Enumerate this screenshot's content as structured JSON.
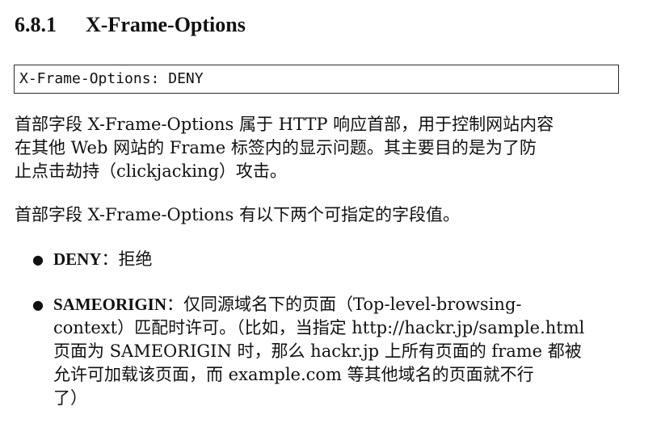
{
  "section": {
    "number": "6.8.1",
    "title": "X-Frame-Options"
  },
  "code": "X-Frame-Options: DENY",
  "paragraph1": [
    "首部字段 X-Frame-Options 属于 HTTP 响应首部，用于控制网站内容",
    "在其他 Web 网站的 Frame 标签内的显示问题。其主要目的是为了防",
    "止点击劫持（clickjacking）攻击。"
  ],
  "paragraph2": "首部字段 X-Frame-Options 有以下两个可指定的字段值。",
  "bullets": [
    {
      "marker": "●",
      "term": "DENY",
      "separator": "：",
      "lines": [
        "拒绝"
      ]
    },
    {
      "marker": "●",
      "term": "SAMEORIGIN",
      "separator": "：",
      "lines": [
        "仅同源域名下的页面（Top-level-browsing-",
        "context）匹配时许可。（比如，当指定 http://hackr.jp/sample.html",
        "页面为 SAMEORIGIN 时，那么 hackr.jp 上所有页面的 frame 都被",
        "允许可加载该页面，而 example.com 等其他域名的页面就不行",
        "了）"
      ]
    }
  ]
}
